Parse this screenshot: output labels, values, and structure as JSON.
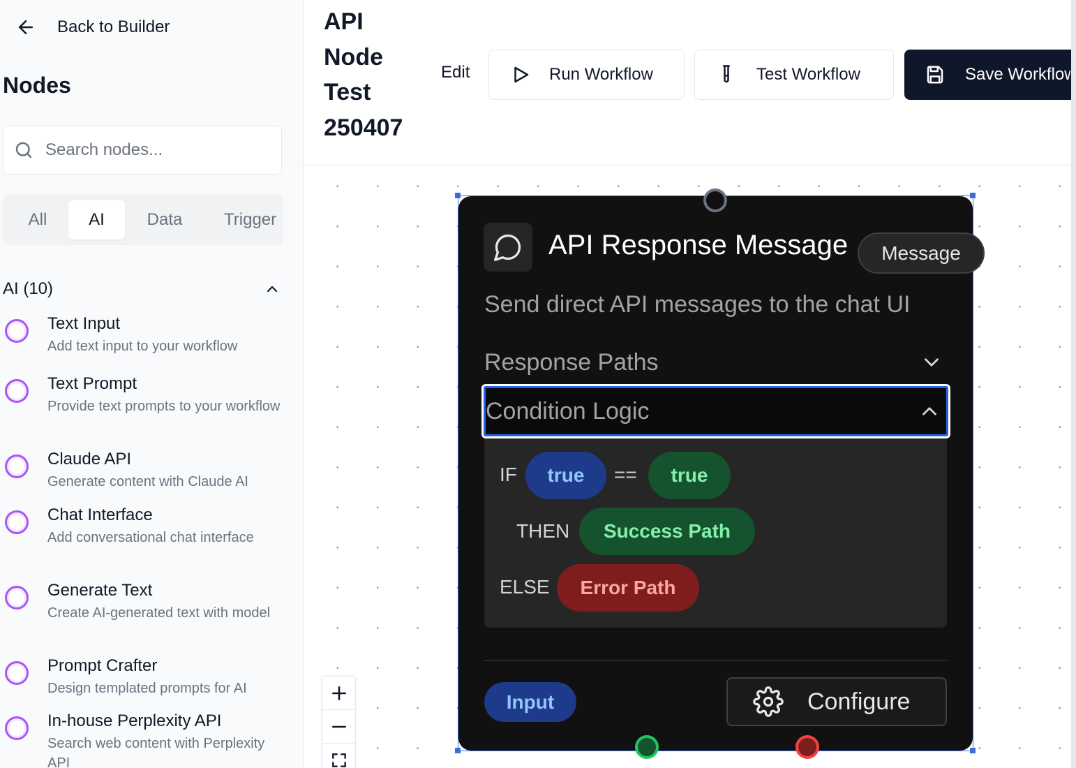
{
  "sidebar": {
    "back_label": "Back to Builder",
    "title": "Nodes",
    "search_placeholder": "Search nodes...",
    "tabs": [
      {
        "label": "All",
        "active": false
      },
      {
        "label": "AI",
        "active": true
      },
      {
        "label": "Data",
        "active": false
      },
      {
        "label": "Trigger",
        "active": false
      }
    ],
    "section_label": "AI (10)",
    "items": [
      {
        "name": "Text Input",
        "desc": "Add text input to your workflow"
      },
      {
        "name": "Text Prompt",
        "desc": "Provide text prompts to your workflow"
      },
      {
        "name": "Claude API",
        "desc": "Generate content with Claude AI"
      },
      {
        "name": "Chat Interface",
        "desc": "Add conversational chat interface"
      },
      {
        "name": "Generate Text",
        "desc": "Create AI-generated text with model"
      },
      {
        "name": "Prompt Crafter",
        "desc": "Design templated prompts for AI"
      },
      {
        "name": "In-house Perplexity API",
        "desc": "Search web content with Perplexity API"
      }
    ]
  },
  "header": {
    "title": "API Node Test 250407",
    "edit_label": "Edit",
    "run_label": "Run Workflow",
    "test_label": "Test Workflow",
    "save_label": "Save Workflow"
  },
  "node": {
    "title": "API Response Message",
    "badge": "Message",
    "description": "Send direct API messages to the chat UI",
    "response_paths_label": "Response Paths",
    "condition_logic_label": "Condition Logic",
    "logic": {
      "if_kw": "IF",
      "left_operand": "true",
      "operator": "==",
      "right_operand": "true",
      "then_kw": "THEN",
      "then_path": "Success Path",
      "else_kw": "ELSE",
      "else_path": "Error Path"
    },
    "input_label": "Input",
    "configure_label": "Configure",
    "colors": {
      "success_port": "#22c55e",
      "error_port": "#ef4444",
      "input_port": "#6b7280"
    }
  },
  "icons": [
    "arrow-left-icon",
    "search-icon",
    "chevron-up-icon",
    "play-icon",
    "test-tube-icon",
    "save-icon",
    "message-circle-icon",
    "chevron-down-icon",
    "gear-icon",
    "plus-icon",
    "minus-icon",
    "fit-view-icon"
  ]
}
